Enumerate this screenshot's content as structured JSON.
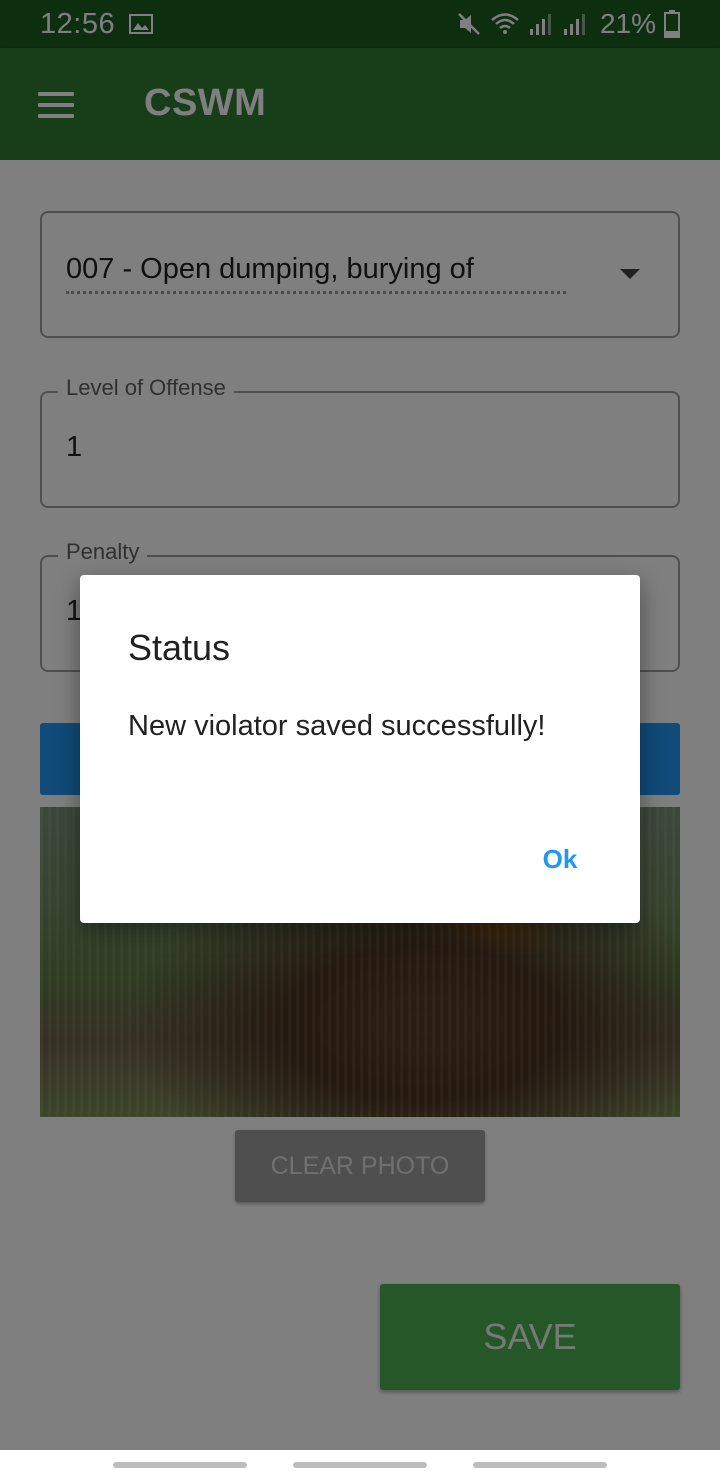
{
  "status_bar": {
    "time": "12:56",
    "battery": "21%",
    "icons": [
      "gallery-icon",
      "mute-icon",
      "wifi-icon",
      "signal-icon",
      "signal-icon",
      "battery-icon"
    ]
  },
  "app_bar": {
    "title": "CSWM",
    "menu_icon": "hamburger-menu-icon"
  },
  "form": {
    "violation_select": {
      "value": "007 - Open dumping, burying of"
    },
    "level_of_offense": {
      "label": "Level of Offense",
      "value": "1"
    },
    "penalty": {
      "label": "Penalty",
      "value": "1"
    },
    "clear_photo_label": "CLEAR PHOTO",
    "save_label": "SAVE"
  },
  "dialog": {
    "title": "Status",
    "message": "New violator saved successfully!",
    "ok_label": "Ok"
  },
  "colors": {
    "status_bar": "#1b5e20",
    "app_bar": "#2e7d32",
    "primary_blue": "#2196f3",
    "save_green": "#4caf50"
  }
}
